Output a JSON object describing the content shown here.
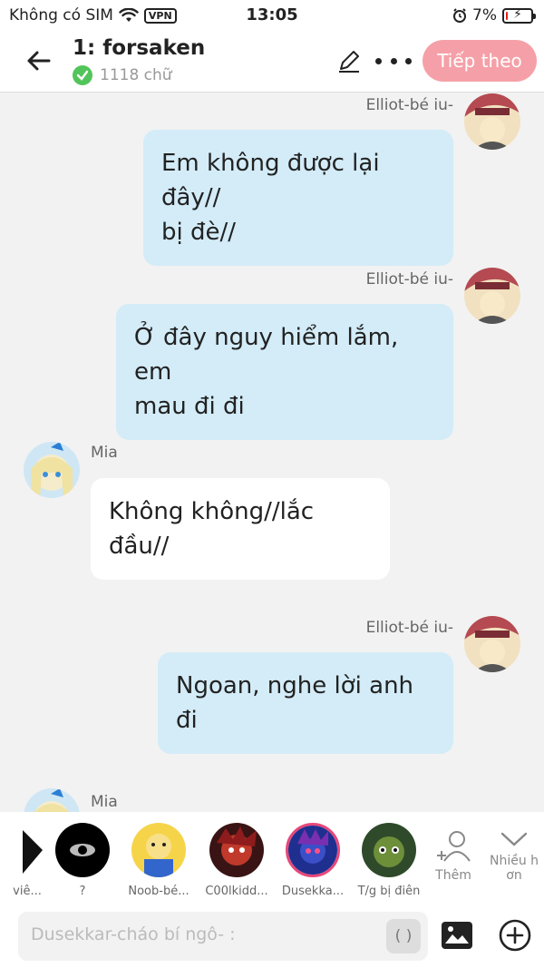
{
  "status_bar": {
    "carrier": "Không có SIM",
    "vpn": "VPN",
    "time": "13:05",
    "battery_text": "7%",
    "battery_level": 0.07
  },
  "header": {
    "title": "1: forsaken",
    "word_count": "1118 chữ",
    "next_label": "Tiếp theo"
  },
  "messages": [
    {
      "sender": "Elliot-bé iu-",
      "text_lines": [
        "Em không được lại đây//",
        "bị đè//"
      ]
    },
    {
      "sender": "Elliot-bé iu-",
      "text_lines": [
        "Ở đây nguy hiểm lắm, em",
        "mau đi đi"
      ]
    },
    {
      "sender": "Mia",
      "text_lines": [
        "Không không//lắc đầu//"
      ]
    },
    {
      "sender": "Elliot-bé iu-",
      "text_lines": [
        "Ngoan, nghe lời anh đi"
      ]
    },
    {
      "sender": "Mia",
      "text_lines": []
    }
  ],
  "characters": [
    {
      "label": "viê..."
    },
    {
      "label": "?"
    },
    {
      "label": "Noob-bé..."
    },
    {
      "label": "C00lkidd..."
    },
    {
      "label": "Dusekka..."
    },
    {
      "label": "T/g bị điên"
    }
  ],
  "strip_actions": {
    "add_label": "Thêm",
    "more_label_1": "Nhiều h",
    "more_label_2": "ơn"
  },
  "input": {
    "placeholder": "Dusekkar-cháo bí ngô- :",
    "paren": "( )"
  },
  "colors": {
    "accent": "#f5a0a8",
    "outgoing_bubble": "#d3ecf8",
    "check": "#52c55a"
  }
}
